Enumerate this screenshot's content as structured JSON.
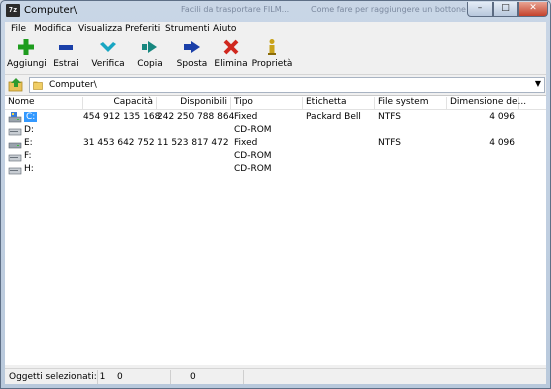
{
  "window": {
    "title": "Computer\\",
    "app_icon_text": "7z"
  },
  "background_ghost": {
    "left": "Facili da trasportare FILM...",
    "right": "Come fare per raggiungere un bottone"
  },
  "controls": {
    "minimize": "–",
    "maximize": "□",
    "close": "✕"
  },
  "menu": [
    "File",
    "Modifica",
    "Visualizza",
    "Preferiti",
    "Strumenti",
    "Aiuto"
  ],
  "toolbar": [
    {
      "label": "Aggiungi",
      "icon": "plus-icon",
      "color": "#1e9c1e"
    },
    {
      "label": "Estrai",
      "icon": "minus-icon",
      "color": "#1a3fa8"
    },
    {
      "label": "Verifica",
      "icon": "check-icon",
      "color": "#18a6c2"
    },
    {
      "label": "Copia",
      "icon": "copy-arrow-icon",
      "color": "#17877f"
    },
    {
      "label": "Sposta",
      "icon": "move-arrow-icon",
      "color": "#1a3fa8"
    },
    {
      "label": "Elimina",
      "icon": "delete-x-icon",
      "color": "#d0281f"
    },
    {
      "label": "Proprietà",
      "icon": "info-icon",
      "color": "#c9a21a"
    }
  ],
  "address": {
    "path": "Computer\\"
  },
  "columns": {
    "name": "Nome",
    "capacity": "Capacità",
    "available": "Disponibili",
    "type": "Tipo",
    "label": "Etichetta",
    "filesystem": "File system",
    "cluster": "Dimensione de..."
  },
  "drives": [
    {
      "name": "C:",
      "capacity": "454 912 135 168",
      "available": "242 250 788 864",
      "type": "Fixed",
      "label": "Packard Bell",
      "filesystem": "NTFS",
      "cluster": "4 096",
      "icon": "hard-disk-icon"
    },
    {
      "name": "D:",
      "capacity": "",
      "available": "",
      "type": "CD-ROM",
      "label": "",
      "filesystem": "",
      "cluster": "",
      "icon": "cd-drive-icon"
    },
    {
      "name": "E:",
      "capacity": "31 453 642 752",
      "available": "11 523 817 472",
      "type": "Fixed",
      "label": "",
      "filesystem": "NTFS",
      "cluster": "4 096",
      "icon": "hard-disk-icon"
    },
    {
      "name": "F:",
      "capacity": "",
      "available": "",
      "type": "CD-ROM",
      "label": "",
      "filesystem": "",
      "cluster": "",
      "icon": "cd-drive-icon"
    },
    {
      "name": "H:",
      "capacity": "",
      "available": "",
      "type": "CD-ROM",
      "label": "",
      "filesystem": "",
      "cluster": "",
      "icon": "cd-drive-icon"
    }
  ],
  "status": {
    "selected": "Oggetti selezionati: 1",
    "size": "0",
    "packed": "0"
  }
}
